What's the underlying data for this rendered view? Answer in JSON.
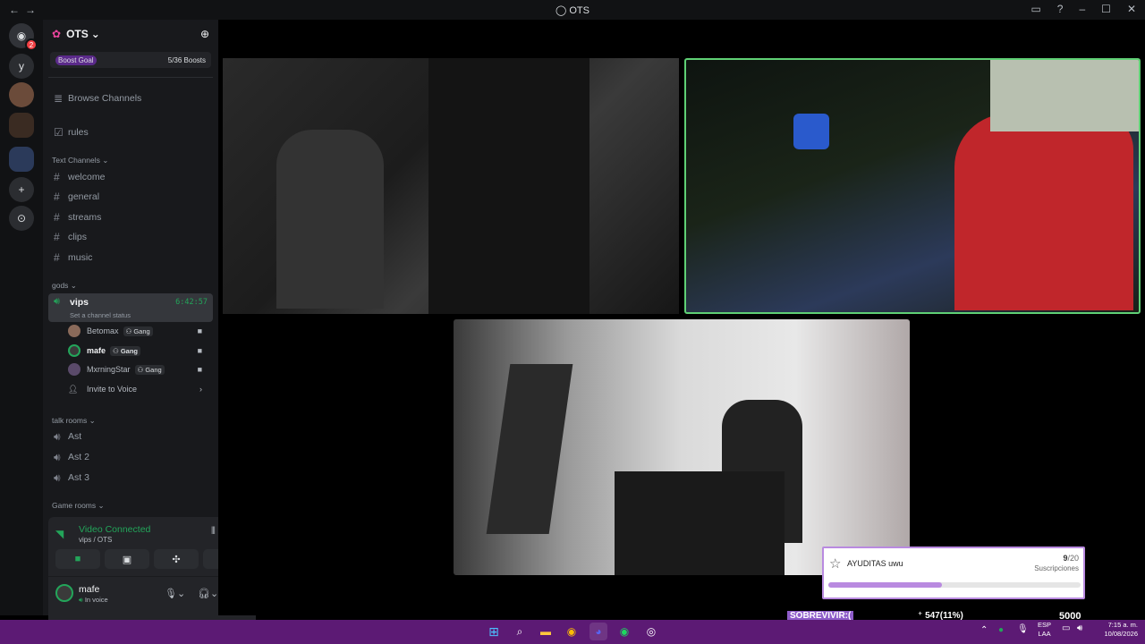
{
  "window": {
    "title": "OTS"
  },
  "guilds": {
    "dm_badge": "2",
    "items": [
      "y"
    ]
  },
  "server": {
    "name": "OTS",
    "boost_label": "Boost Goal",
    "boost_count": "5/36 Boosts"
  },
  "sidebar": {
    "browse": "Browse Channels",
    "rules": "rules",
    "text_cat": "Text Channels",
    "text_channels": [
      "welcome",
      "general",
      "streams",
      "clips",
      "music"
    ],
    "gods_cat": "gods",
    "voice": {
      "name": "vips",
      "timer": "6:42:57",
      "status": "Set a channel status"
    },
    "users": [
      {
        "name": "Betomax",
        "tag": "Gang"
      },
      {
        "name": "mafe",
        "tag": "Gang"
      },
      {
        "name": "MxrningStar",
        "tag": "Gang"
      }
    ],
    "invite": "Invite to Voice",
    "talk_cat": "talk rooms",
    "talk": [
      "Ast",
      "Ast 2",
      "Ast 3"
    ],
    "game_cat": "Game rooms"
  },
  "voice_panel": {
    "status": "Video Connected",
    "location": "vips / OTS"
  },
  "user_panel": {
    "name": "mafe",
    "status": "In voice"
  },
  "overlay": {
    "goal_title": "AYUDITAS uwu",
    "goal_current": "9",
    "goal_total": "/20",
    "goal_unit": "Suscripciones",
    "goal_progress": 0.45,
    "left_text": "SOBREVIVIR:(",
    "mid_text": "547(11%)",
    "right_text": "5000"
  },
  "tray": {
    "lang1": "ESP",
    "lang2": "LAA",
    "time": "7:15 a. m.",
    "date": "10/08/2026"
  },
  "colors": {
    "accent": "#23a55a",
    "taskbar": "#5c1a74",
    "progress": "#b98ae0"
  }
}
